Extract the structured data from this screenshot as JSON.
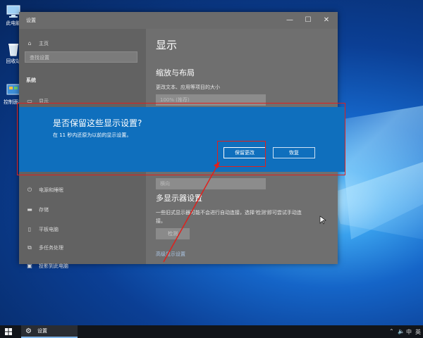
{
  "desktop": {
    "icons": [
      {
        "label": "此电脑",
        "icon": "pc-icon"
      },
      {
        "label": "回收站",
        "icon": "recycle-bin-icon"
      },
      {
        "label": "控制面板",
        "icon": "control-panel-icon"
      }
    ]
  },
  "window": {
    "title": "设置",
    "controls": {
      "minimize": "—",
      "maximize": "☐",
      "close": "✕"
    }
  },
  "sidebar": {
    "home": "主页",
    "search_placeholder": "查找设置",
    "section": "系统",
    "items": [
      "显示",
      "电源和睡眠",
      "存储",
      "平板电脑",
      "多任务处理",
      "投影到此电脑"
    ]
  },
  "content": {
    "title": "显示",
    "scale_heading": "缩放与布局",
    "scale_label": "更改文本、应用等项目的大小",
    "scale_value": "100% (推荐)",
    "orientation_value": "横向",
    "multi_heading": "多显示器设置",
    "multi_desc_line1": "一些旧式显示器可能不会进行自动连接，选择'检测'即可尝试手动连",
    "multi_desc_line2": "接。",
    "detect_button": "检测",
    "advanced_link": "高级显示设置"
  },
  "dialog": {
    "title": "是否保留这些显示设置?",
    "subtitle": "在 11 秒内还原为以前的显示设置。",
    "keep_button": "保留更改",
    "revert_button": "恢复"
  },
  "taskbar": {
    "app_label": "设置",
    "lang": "英"
  },
  "colors": {
    "dialog_bg": "#0f6fbd",
    "annotation_red": "#e0201c"
  }
}
